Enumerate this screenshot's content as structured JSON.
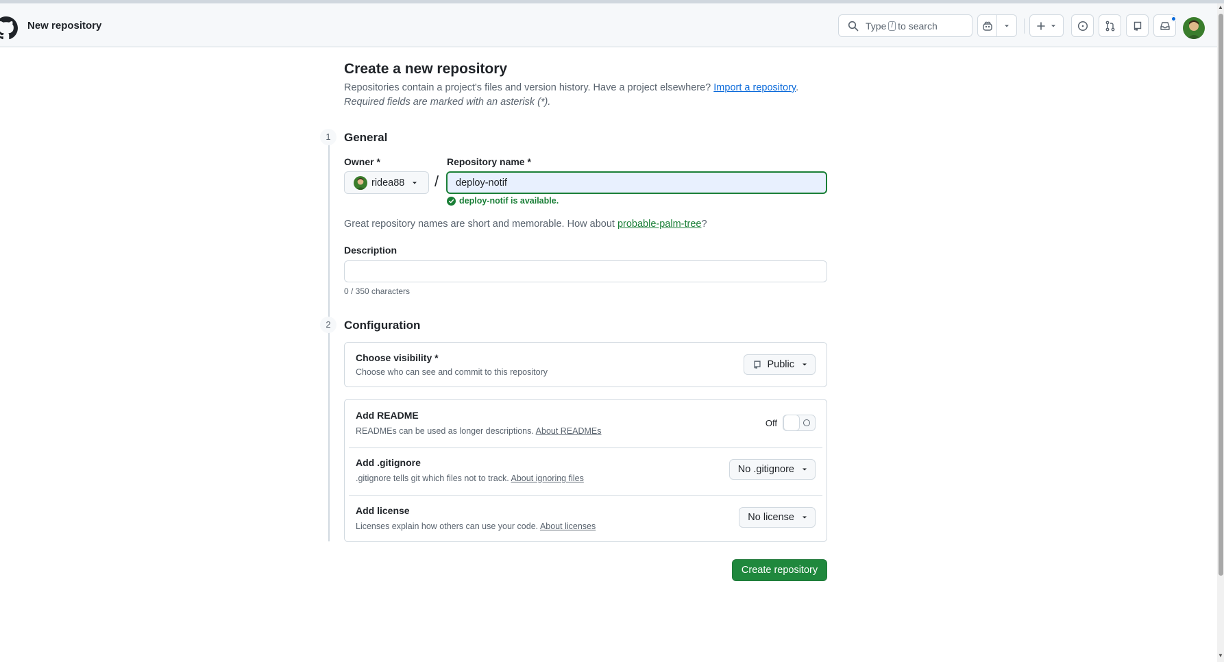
{
  "header": {
    "title": "New repository",
    "search": {
      "prefix": "Type",
      "key": "/",
      "suffix": "to search"
    }
  },
  "page": {
    "title": "Create a new repository",
    "intro": "Repositories contain a project's files and version history. Have a project elsewhere?",
    "import_link": "Import a repository",
    "intro_end": ".",
    "required_note": "Required fields are marked with an asterisk (*)."
  },
  "general": {
    "step": "1",
    "title": "General",
    "owner_label": "Owner *",
    "owner_value": "ridea88",
    "slash": "/",
    "name_label": "Repository name *",
    "name_value": "deploy-notif",
    "availability": "deploy-notif is available.",
    "suggest_prefix": "Great repository names are short and memorable. How about",
    "suggest_name": "probable-palm-tree",
    "suggest_suffix": "?",
    "description_label": "Description",
    "description_value": "",
    "char_count": "0 / 350 characters"
  },
  "configuration": {
    "step": "2",
    "title": "Configuration",
    "visibility": {
      "title": "Choose visibility *",
      "desc": "Choose who can see and commit to this repository",
      "value": "Public"
    },
    "readme": {
      "title": "Add README",
      "desc": "READMEs can be used as longer descriptions.",
      "link": "About READMEs",
      "toggle_label": "Off",
      "toggle_state": "off"
    },
    "gitignore": {
      "title": "Add .gitignore",
      "desc": ".gitignore tells git which files not to track.",
      "link": "About ignoring files",
      "value": "No .gitignore"
    },
    "license": {
      "title": "Add license",
      "desc": "Licenses explain how others can use your code.",
      "link": "About licenses",
      "value": "No license"
    }
  },
  "actions": {
    "create": "Create repository"
  },
  "colors": {
    "primary_button": "#1f883d",
    "success_text": "#1a7f37",
    "link": "#0969da",
    "notification_dot": "#0969da"
  }
}
